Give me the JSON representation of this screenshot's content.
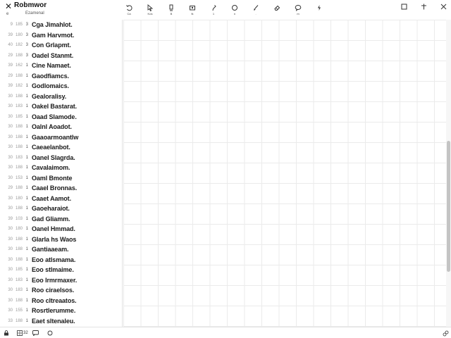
{
  "window": {
    "title": "Robmwor",
    "subtitle": "Ezamenal",
    "close_glyph": "✕",
    "back_glyph": "e"
  },
  "toolbar": [
    {
      "icon": "undo-icon",
      "label": "Ca"
    },
    {
      "icon": "pointer-icon",
      "label": "Kos"
    },
    {
      "icon": "text-icon",
      "label": "B"
    },
    {
      "icon": "image-icon",
      "label": "fk"
    },
    {
      "icon": "pen-icon",
      "label": "1"
    },
    {
      "icon": "shape-icon",
      "label": "n"
    },
    {
      "icon": "brush-icon",
      "label": "."
    },
    {
      "icon": "eraser-icon",
      "label": ""
    },
    {
      "icon": "comment-icon",
      "label": "m"
    },
    {
      "icon": "lightning-icon",
      "label": ""
    }
  ],
  "window_controls": [
    "minimize-icon",
    "pin-icon",
    "close-icon"
  ],
  "rows": [
    {
      "a": "9",
      "b": "185",
      "c": "3",
      "label": "Cga Jimahlot."
    },
    {
      "a": "39",
      "b": "180",
      "c": "3",
      "label": "Gam Harvmot."
    },
    {
      "a": "40",
      "b": "182",
      "c": "3",
      "label": "Con Grlapmt."
    },
    {
      "a": "29",
      "b": "188",
      "c": "3",
      "label": "Oadel Stanmt."
    },
    {
      "a": "39",
      "b": "162",
      "c": "1",
      "label": "Cine Namaet."
    },
    {
      "a": "29",
      "b": "188",
      "c": "1",
      "label": "Gaodfiamcs."
    },
    {
      "a": "39",
      "b": "182",
      "c": "1",
      "label": "Godlomaics."
    },
    {
      "a": "30",
      "b": "188",
      "c": "1",
      "label": "Gealoralisy."
    },
    {
      "a": "30",
      "b": "183",
      "c": "1",
      "label": "Oakel Bastarat."
    },
    {
      "a": "30",
      "b": "185",
      "c": "1",
      "label": "Oaad Slamode."
    },
    {
      "a": "30",
      "b": "188",
      "c": "1",
      "label": "Oalnl Aoadot."
    },
    {
      "a": "30",
      "b": "188",
      "c": "1",
      "label": "Gaaoarmoantlw"
    },
    {
      "a": "30",
      "b": "188",
      "c": "1",
      "label": "Caeaelanbot."
    },
    {
      "a": "30",
      "b": "183",
      "c": "1",
      "label": "Oanel Slagrda."
    },
    {
      "a": "30",
      "b": "188",
      "c": "1",
      "label": "Cavalaimom."
    },
    {
      "a": "30",
      "b": "153",
      "c": "1",
      "label": "Oaml Bmonte"
    },
    {
      "a": "29",
      "b": "188",
      "c": "1",
      "label": "Caael Bronnas."
    },
    {
      "a": "30",
      "b": "180",
      "c": "1",
      "label": "Caaet Aamot."
    },
    {
      "a": "30",
      "b": "188",
      "c": "1",
      "label": "Gaoeharaiot."
    },
    {
      "a": "39",
      "b": "103",
      "c": "1",
      "label": "Gad Gliamm."
    },
    {
      "a": "30",
      "b": "180",
      "c": "1",
      "label": "Oanel Hmmad."
    },
    {
      "a": "30",
      "b": "188",
      "c": "1",
      "label": "Glarla hs Waos"
    },
    {
      "a": "30",
      "b": "188",
      "c": "1",
      "label": "Gantiaaeam."
    },
    {
      "a": "30",
      "b": "188",
      "c": "1",
      "label": "Eoo atlsmama."
    },
    {
      "a": "30",
      "b": "185",
      "c": "1",
      "label": "Eoo stlmaime."
    },
    {
      "a": "30",
      "b": "183",
      "c": "1",
      "label": "Eoo Irmrmaxer."
    },
    {
      "a": "30",
      "b": "183",
      "c": "1",
      "label": "Roo ciraelsos."
    },
    {
      "a": "30",
      "b": "188",
      "c": "1",
      "label": "Roo cltreaatos."
    },
    {
      "a": "30",
      "b": "155",
      "c": "1",
      "label": "Rosrtlerumme."
    },
    {
      "a": "33",
      "b": "188",
      "c": "1",
      "label": "Eaet sltenaleu."
    }
  ],
  "statusbar": {
    "left": [
      {
        "icon": "lock-icon",
        "label": ""
      },
      {
        "icon": "grid-icon",
        "label": "32"
      },
      {
        "icon": "chat-icon",
        "label": ""
      },
      {
        "icon": "circle-icon",
        "label": ""
      }
    ],
    "right_icon": "resize-icon"
  },
  "colors": {
    "accent": "#1a1a1a",
    "grid_line": "#ebebeb",
    "scroll_thumb": "#c4c4c4"
  }
}
